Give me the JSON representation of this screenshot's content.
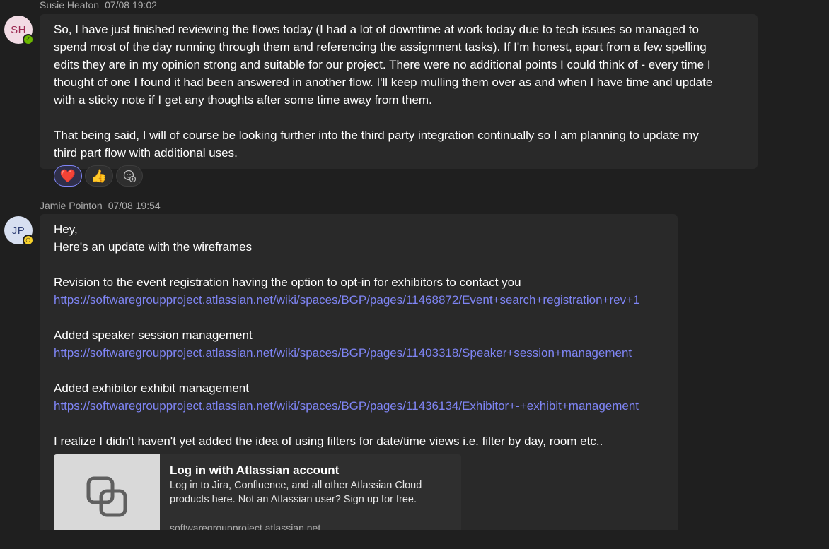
{
  "messages": [
    {
      "author": "Susie Heaton",
      "time": "07/08 19:02",
      "initials": "SH",
      "presence": "available",
      "paragraph_1": [
        "So, I have just finished reviewing the flows today (I had a lot of downtime at work today due to tech issues so managed to",
        "spend most of the day running through them and referencing the assignment tasks). If I'm honest, apart from a few spelling",
        "edits they are in my opinion strong and suitable for our project. There were no additional points I could think of - every time I",
        "thought of one I found it had been answered in another flow. I'll keep mulling them over as and when I have time and update",
        "with a sticky note if I get any thoughts after some time away from them."
      ],
      "paragraph_2": [
        "That being said, I will of course be looking further into the third party integration continually so I am planning to update my",
        "third part flow with additional uses."
      ],
      "reactions": [
        {
          "emoji": "❤️",
          "icon": "heart-icon",
          "active": true
        },
        {
          "emoji": "👍",
          "icon": "thumbs-up-icon",
          "active": false
        }
      ],
      "add_reaction_icon": "add-reaction-icon"
    },
    {
      "author": "Jamie Pointon",
      "time": "07/08 19:54",
      "initials": "JP",
      "presence": "away",
      "greeting": "Hey,",
      "intro": "Here's an update with the wireframes",
      "item_1_text": "Revision to the event registration having the option to opt-in for exhibitors to contact you",
      "item_1_link": "https://softwaregroupproject.atlassian.net/wiki/spaces/BGP/pages/11468872/Event+search+registration+rev+1",
      "item_2_text": "Added speaker session management",
      "item_2_link": "https://softwaregroupproject.atlassian.net/wiki/spaces/BGP/pages/11403318/Speaker+session+management",
      "item_3_text": "Added exhibitor exhibit management",
      "item_3_link": "https://softwaregroupproject.atlassian.net/wiki/spaces/BGP/pages/11436134/Exhibitor+-+exhibit+management",
      "closing": "I realize I didn't haven't yet added the idea of using filters for date/time views i.e. filter by day, room etc..",
      "card": {
        "title": "Log in with Atlassian account",
        "description_1": "Log in to Jira, Confluence, and all other Atlassian Cloud",
        "description_2": "products here. Not an Atlassian user? Sign up for free.",
        "domain": "softwaregroupproject.atlassian.net",
        "thumb_icon": "link-preview-icon"
      }
    }
  ],
  "colors": {
    "background": "#1f1f1f",
    "bubble": "#292929",
    "link": "#7f85f5",
    "meta_text": "#adadad",
    "presence_available": "#6bb700",
    "presence_away": "#f8d22a"
  }
}
